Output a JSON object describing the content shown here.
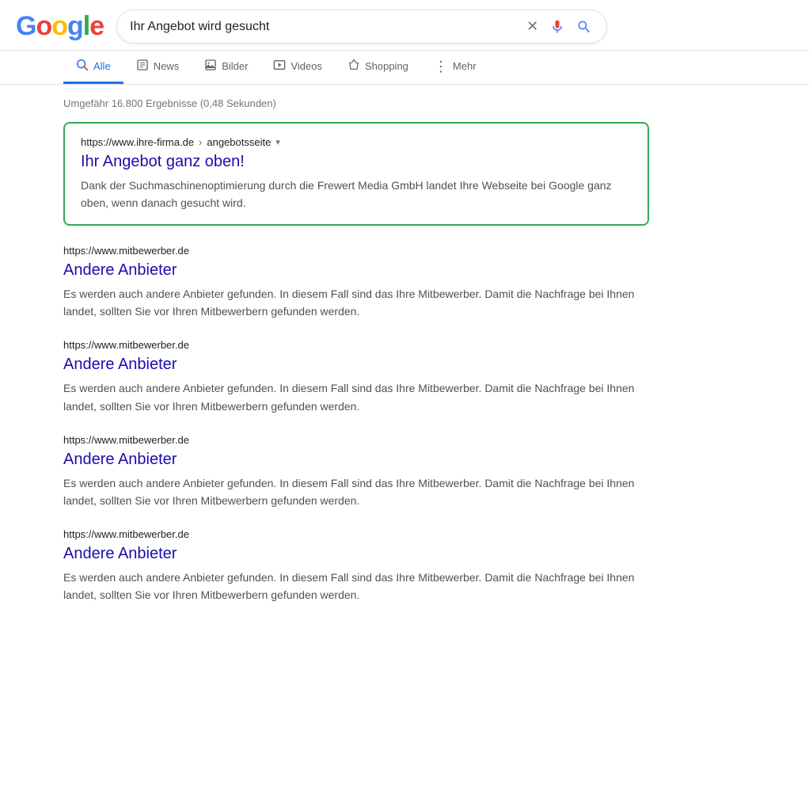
{
  "header": {
    "logo_letters": [
      "G",
      "o",
      "o",
      "g",
      "l",
      "e"
    ],
    "search_value": "Ihr Angebot wird gesucht",
    "clear_button_label": "×",
    "mic_icon_label": "mic-icon",
    "search_icon_label": "search-icon"
  },
  "nav": {
    "tabs": [
      {
        "id": "alle",
        "label": "Alle",
        "active": true,
        "icon": "search"
      },
      {
        "id": "news",
        "label": "News",
        "active": false,
        "icon": "news"
      },
      {
        "id": "bilder",
        "label": "Bilder",
        "active": false,
        "icon": "images"
      },
      {
        "id": "videos",
        "label": "Videos",
        "active": false,
        "icon": "video"
      },
      {
        "id": "shopping",
        "label": "Shopping",
        "active": false,
        "icon": "shopping"
      },
      {
        "id": "mehr",
        "label": "Mehr",
        "active": false,
        "icon": "more"
      }
    ]
  },
  "results": {
    "count_text": "Umgefähr 16.800 Ergebnisse (0,48 Sekunden)",
    "featured": {
      "url": "https://www.ihre-firma.de",
      "breadcrumb": "angebotsseite",
      "title": "Ihr Angebot ganz oben!",
      "snippet": "Dank der Suchmaschinenoptimierung durch die Frewert Media GmbH landet Ihre Webseite bei Google ganz oben, wenn danach gesucht wird."
    },
    "items": [
      {
        "url": "https://www.mitbewerber.de",
        "title": "Andere Anbieter",
        "snippet": "Es werden auch andere Anbieter gefunden. In diesem Fall sind das Ihre Mitbewerber. Damit die Nachfrage bei Ihnen landet, sollten Sie vor Ihren Mitbewerbern gefunden werden."
      },
      {
        "url": "https://www.mitbewerber.de",
        "title": "Andere Anbieter",
        "snippet": "Es werden auch andere Anbieter gefunden. In diesem Fall sind das Ihre Mitbewerber. Damit die Nachfrage bei Ihnen landet, sollten Sie vor Ihren Mitbewerbern gefunden werden."
      },
      {
        "url": "https://www.mitbewerber.de",
        "title": "Andere Anbieter",
        "snippet": "Es werden auch andere Anbieter gefunden. In diesem Fall sind das Ihre Mitbewerber. Damit die Nachfrage bei Ihnen landet, sollten Sie vor Ihren Mitbewerbern gefunden werden."
      },
      {
        "url": "https://www.mitbewerber.de",
        "title": "Andere Anbieter",
        "snippet": "Es werden auch andere Anbieter gefunden. In diesem Fall sind das Ihre Mitbewerber. Damit die Nachfrage bei Ihnen landet, sollten Sie vor Ihren Mitbewerbern gefunden werden."
      }
    ]
  }
}
